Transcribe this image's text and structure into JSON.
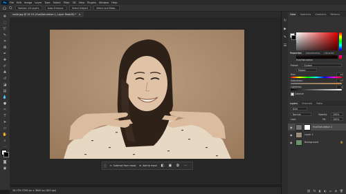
{
  "menubar": {
    "app_icon": "Ps",
    "items": [
      "File",
      "Edit",
      "Image",
      "Layer",
      "Type",
      "Select",
      "Filter",
      "3D",
      "View",
      "Plugins",
      "Window",
      "Help"
    ]
  },
  "options": {
    "chips": [
      "Sample: All Layers",
      "Auto-Enhance",
      "Select Subject",
      "Select and Mask..."
    ]
  },
  "document": {
    "tab_label": "smile.jpg @ 16.1% (Hue/Saturation 1, Layer Mask/8) *",
    "zoom": "16.13%",
    "status_text": "16.13%   5760 px × 3840 px (300 ppi)"
  },
  "context_bar": {
    "subtract_label": "Subtract from mask",
    "add_label": "Add to mask",
    "more_label": "···"
  },
  "color_panel": {
    "tabs": [
      "Color",
      "Swatches",
      "Gradients",
      "Patterns"
    ],
    "hue_color": "#e20000"
  },
  "properties_panel": {
    "tabs": [
      "Properties",
      "Adjustments",
      "Libraries"
    ],
    "title": "Hue/Saturation",
    "preset_label": "Preset:",
    "preset_value": "Custom",
    "channel_value": "Master",
    "hue_label": "Hue:",
    "hue_value": "24",
    "saturation_label": "Saturation:",
    "saturation_value": "17",
    "lightness_label": "Lightness:",
    "lightness_value": "0",
    "colorize_label": "Colorize",
    "colorize_checked": true
  },
  "layers_panel": {
    "tabs": [
      "Layers",
      "Channels",
      "Paths"
    ],
    "kind_label": "Kind",
    "blend_mode": "Normal",
    "opacity_label": "Opacity:",
    "opacity_value": "100%",
    "lock_label": "Lock:",
    "fill_label": "Fill:",
    "fill_value": "100%",
    "layers": [
      {
        "name": "Hue/Saturation 1",
        "selected": true
      },
      {
        "name": "Layer 1",
        "selected": false
      },
      {
        "name": "Background",
        "selected": false
      }
    ]
  },
  "colors": {
    "accent": "#31a8ff",
    "sepia_bg": "#b08f70",
    "panel_bg": "#323232"
  }
}
